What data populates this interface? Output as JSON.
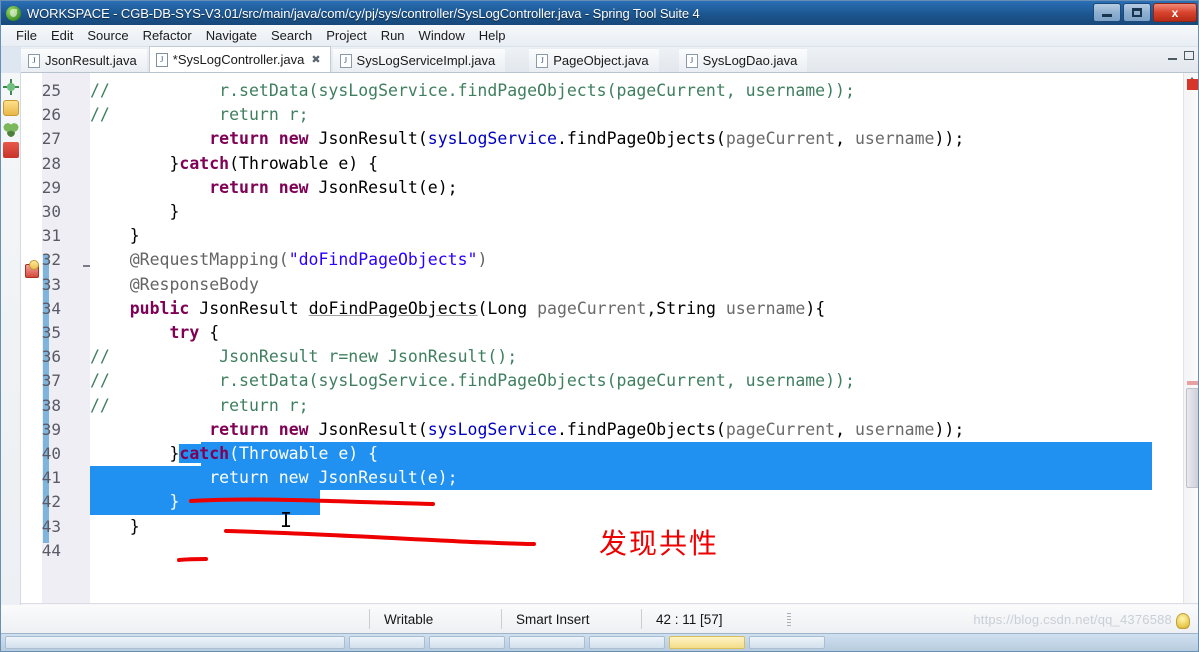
{
  "window": {
    "title": "WORKSPACE - CGB-DB-SYS-V3.01/src/main/java/com/cy/pj/sys/controller/SysLogController.java - Spring Tool Suite 4",
    "app_icon": "sts-icon",
    "minimize_label": "",
    "restore_label": "",
    "close_label": "x"
  },
  "menubar": {
    "items": [
      {
        "label": "File"
      },
      {
        "label": "Edit"
      },
      {
        "label": "Source"
      },
      {
        "label": "Refactor"
      },
      {
        "label": "Navigate"
      },
      {
        "label": "Search"
      },
      {
        "label": "Project"
      },
      {
        "label": "Run"
      },
      {
        "label": "Window"
      },
      {
        "label": "Help"
      }
    ]
  },
  "tabs": [
    {
      "label": "JsonResult.java",
      "active": false,
      "dirty": false,
      "closable": false
    },
    {
      "label": "*SysLogController.java",
      "active": true,
      "dirty": true,
      "closable": true
    },
    {
      "label": "SysLogServiceImpl.java",
      "active": false,
      "dirty": false,
      "closable": false
    },
    {
      "label": "PageObject.java",
      "active": false,
      "dirty": false,
      "closable": false
    },
    {
      "label": "SysLogDao.java",
      "active": false,
      "dirty": false,
      "closable": false
    }
  ],
  "left_toolbar": {
    "icons": [
      "bug-icon",
      "thumbs-up-icon",
      "team-icon",
      "debug-stack-icon"
    ]
  },
  "right_toolbar": {
    "icons": [
      "outline-icon",
      "breakpoints-icon",
      "variables-icon",
      "copy-icon",
      "console-icon",
      "error-log-icon",
      "javadoc-icon",
      "install-icon",
      "progress-icon"
    ]
  },
  "editor": {
    "file": "SysLogController.java",
    "first_visible_line": 25,
    "last_visible_line": 44,
    "selected_lines": [
      40,
      41,
      42
    ],
    "change_bar_range": [
      32,
      43
    ],
    "error_marker_line": 34,
    "fold_marker_line": 32,
    "lines": [
      {
        "n": 25,
        "tokens": [
          {
            "t": "// ",
            "c": "cmt"
          },
          {
            "t": "          r.setData(sysLogService.findPageObjects(pageCurrent, username));",
            "c": "cmt"
          }
        ]
      },
      {
        "n": 26,
        "tokens": [
          {
            "t": "// ",
            "c": "cmt"
          },
          {
            "t": "          return r;",
            "c": "cmt"
          }
        ]
      },
      {
        "n": 27,
        "tokens": [
          {
            "t": "            ",
            "c": "plain"
          },
          {
            "t": "return",
            "c": "kw"
          },
          {
            "t": " ",
            "c": "plain"
          },
          {
            "t": "new",
            "c": "kw"
          },
          {
            "t": " JsonResult(",
            "c": "plain"
          },
          {
            "t": "sysLogService",
            "c": "fld"
          },
          {
            "t": ".findPageObjects(",
            "c": "plain"
          },
          {
            "t": "pageCurrent",
            "c": "localvar"
          },
          {
            "t": ", ",
            "c": "plain"
          },
          {
            "t": "username",
            "c": "localvar"
          },
          {
            "t": "));",
            "c": "plain"
          }
        ]
      },
      {
        "n": 28,
        "tokens": [
          {
            "t": "        }",
            "c": "plain"
          },
          {
            "t": "catch",
            "c": "kw"
          },
          {
            "t": "(Throwable e) {",
            "c": "plain"
          }
        ]
      },
      {
        "n": 29,
        "tokens": [
          {
            "t": "            ",
            "c": "plain"
          },
          {
            "t": "return",
            "c": "kw"
          },
          {
            "t": " ",
            "c": "plain"
          },
          {
            "t": "new",
            "c": "kw"
          },
          {
            "t": " JsonResult(e);",
            "c": "plain"
          }
        ]
      },
      {
        "n": 30,
        "tokens": [
          {
            "t": "        }",
            "c": "plain"
          }
        ]
      },
      {
        "n": 31,
        "tokens": [
          {
            "t": "    }",
            "c": "plain"
          }
        ]
      },
      {
        "n": 32,
        "tokens": [
          {
            "t": "    @RequestMapping(",
            "c": "ann"
          },
          {
            "t": "\"doFindPageObjects\"",
            "c": "str"
          },
          {
            "t": ")",
            "c": "ann"
          }
        ]
      },
      {
        "n": 33,
        "tokens": [
          {
            "t": "    @ResponseBody",
            "c": "ann"
          }
        ]
      },
      {
        "n": 34,
        "tokens": [
          {
            "t": "    ",
            "c": "plain"
          },
          {
            "t": "public",
            "c": "kw"
          },
          {
            "t": " JsonResult ",
            "c": "plain"
          },
          {
            "t": "doFindPageObjects",
            "c": "und"
          },
          {
            "t": "(Long ",
            "c": "plain"
          },
          {
            "t": "pageCurrent",
            "c": "localvar"
          },
          {
            "t": ",String ",
            "c": "plain"
          },
          {
            "t": "username",
            "c": "localvar"
          },
          {
            "t": "){",
            "c": "plain"
          }
        ]
      },
      {
        "n": 35,
        "tokens": [
          {
            "t": "        ",
            "c": "plain"
          },
          {
            "t": "try",
            "c": "kw"
          },
          {
            "t": " {",
            "c": "plain"
          }
        ]
      },
      {
        "n": 36,
        "tokens": [
          {
            "t": "// ",
            "c": "cmt"
          },
          {
            "t": "          JsonResult r=new JsonResult();",
            "c": "cmt"
          }
        ]
      },
      {
        "n": 37,
        "tokens": [
          {
            "t": "// ",
            "c": "cmt"
          },
          {
            "t": "          r.setData(sysLogService.findPageObjects(pageCurrent, username));",
            "c": "cmt"
          }
        ]
      },
      {
        "n": 38,
        "tokens": [
          {
            "t": "// ",
            "c": "cmt"
          },
          {
            "t": "          return r;",
            "c": "cmt"
          }
        ]
      },
      {
        "n": 39,
        "tokens": [
          {
            "t": "            ",
            "c": "plain"
          },
          {
            "t": "return",
            "c": "kw"
          },
          {
            "t": " ",
            "c": "plain"
          },
          {
            "t": "new",
            "c": "kw"
          },
          {
            "t": " JsonResult(",
            "c": "plain"
          },
          {
            "t": "sysLogService",
            "c": "fld"
          },
          {
            "t": ".findPageObjects(",
            "c": "plain"
          },
          {
            "t": "pageCurrent",
            "c": "localvar"
          },
          {
            "t": ", ",
            "c": "plain"
          },
          {
            "t": "username",
            "c": "localvar"
          },
          {
            "t": "));",
            "c": "plain"
          }
        ]
      },
      {
        "n": 40,
        "tokens": [
          {
            "t": "        }",
            "c": "plain"
          },
          {
            "t": "catch",
            "c": "kw sel"
          },
          {
            "t": "(Throwable e) {",
            "c": "sel"
          }
        ]
      },
      {
        "n": 41,
        "tokens": [
          {
            "t": "            return new JsonResult(e);",
            "c": "sel"
          }
        ]
      },
      {
        "n": 42,
        "tokens": [
          {
            "t": "        }",
            "c": "sel"
          }
        ]
      },
      {
        "n": 43,
        "tokens": [
          {
            "t": "    }",
            "c": "plain"
          }
        ]
      },
      {
        "n": 44,
        "tokens": [
          {
            "t": "",
            "c": "plain"
          }
        ]
      }
    ]
  },
  "annotations": {
    "note_text": "发现共性",
    "note_color": "#ee0000",
    "underline_color": "#ee0000",
    "underline_count": 3
  },
  "statusbar": {
    "writable": "Writable",
    "insert_mode": "Smart Insert",
    "position": "42 : 11 [57]",
    "watermark": "https://blog.csdn.net/qq_4376588"
  },
  "colors": {
    "selection_blue": "#2091f0",
    "title_blue": "#1c568f",
    "annotation_red": "#ee0000",
    "change_bar_blue": "#7fb4dd",
    "keyword_purple": "#7f0055",
    "comment_green": "#3f7f5f",
    "string_blue": "#2a00ff",
    "field_blue": "#0000c0"
  }
}
